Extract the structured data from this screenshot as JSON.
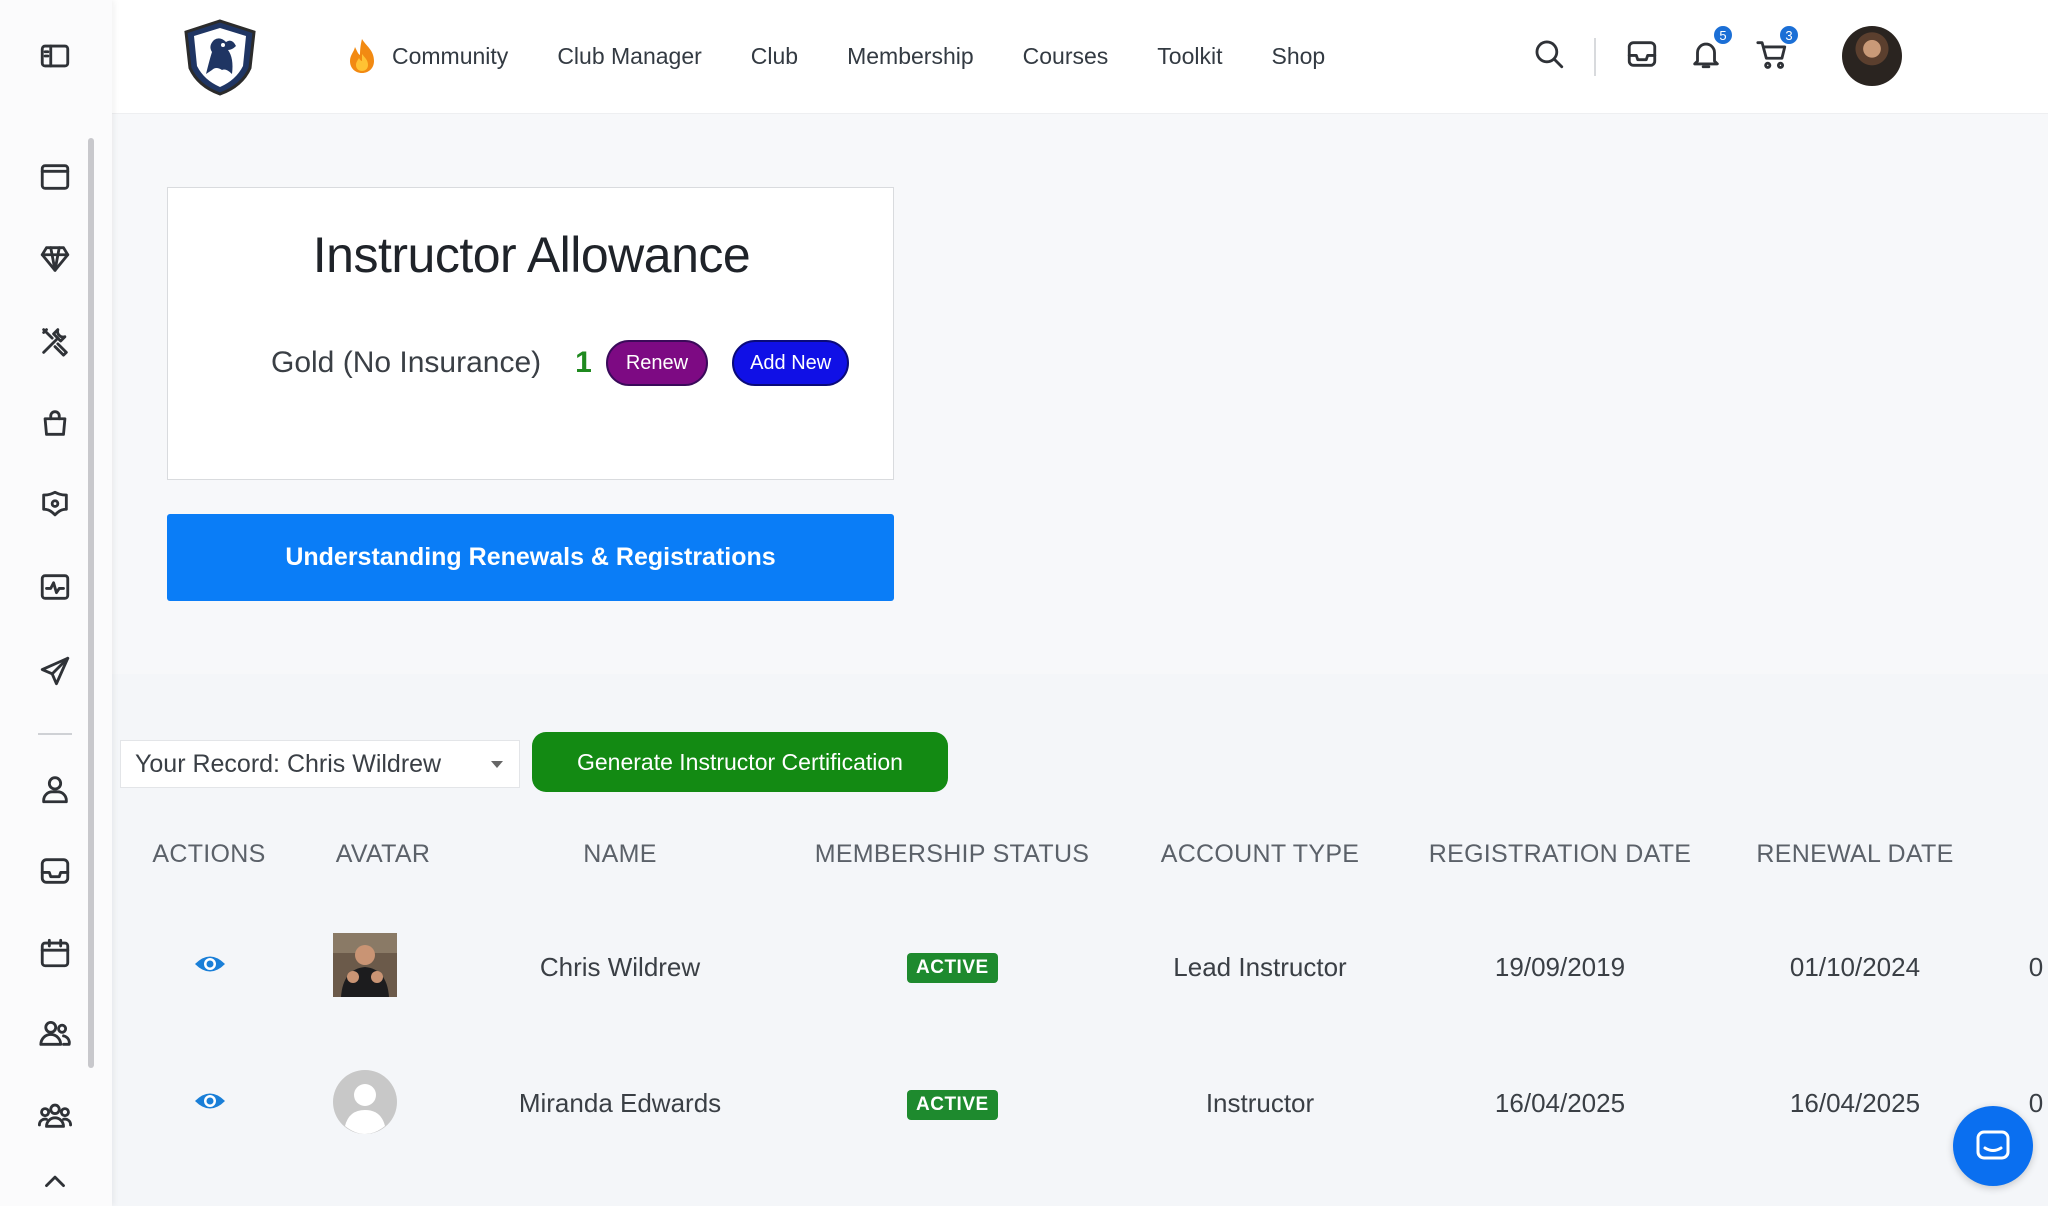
{
  "nav": {
    "items": [
      {
        "label": "Community",
        "icon": "flame-icon"
      },
      {
        "label": "Club Manager"
      },
      {
        "label": "Club"
      },
      {
        "label": "Membership"
      },
      {
        "label": "Courses"
      },
      {
        "label": "Toolkit"
      },
      {
        "label": "Shop"
      }
    ]
  },
  "header": {
    "notifications_count": "5",
    "cart_count": "3"
  },
  "allowance": {
    "title": "Instructor Allowance",
    "level": "Gold (No Insurance)",
    "count": "1",
    "renew_label": "Renew",
    "add_new_label": "Add New"
  },
  "understand_button": "Understanding Renewals & Registrations",
  "record_select": {
    "value": "Your Record: Chris Wildrew"
  },
  "generate_button": "Generate Instructor Certification",
  "table": {
    "headers": [
      "ACTIONS",
      "AVATAR",
      "NAME",
      "MEMBERSHIP STATUS",
      "ACCOUNT TYPE",
      "REGISTRATION DATE",
      "RENEWAL DATE"
    ],
    "rows": [
      {
        "name": "Chris Wildrew",
        "status": "ACTIVE",
        "account_type": "Lead Instructor",
        "registration_date": "19/09/2019",
        "renewal_date": "01/10/2024",
        "extra": "0"
      },
      {
        "name": "Miranda Edwards",
        "status": "ACTIVE",
        "account_type": "Instructor",
        "registration_date": "16/04/2025",
        "renewal_date": "16/04/2025",
        "extra": "0"
      }
    ]
  },
  "colors": {
    "renew": "#7d0a83",
    "add_new": "#1010e6",
    "understand": "#0a7df7",
    "generate": "#138a13",
    "active": "#1e8a2e",
    "eye": "#1a7fd8"
  }
}
